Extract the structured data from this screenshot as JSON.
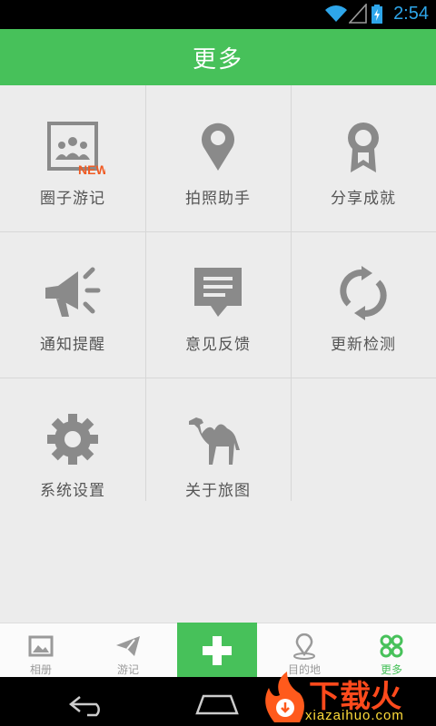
{
  "status_bar": {
    "time": "2:54"
  },
  "header": {
    "title": "更多"
  },
  "grid_items": [
    {
      "label": "圈子游记",
      "icon": "group-journal-icon",
      "badge": "NEW"
    },
    {
      "label": "拍照助手",
      "icon": "location-pin-icon"
    },
    {
      "label": "分享成就",
      "icon": "medal-icon"
    },
    {
      "label": "通知提醒",
      "icon": "megaphone-icon"
    },
    {
      "label": "意见反馈",
      "icon": "feedback-message-icon"
    },
    {
      "label": "更新检测",
      "icon": "refresh-icon"
    },
    {
      "label": "系统设置",
      "icon": "gear-icon"
    },
    {
      "label": "关于旅图",
      "icon": "camel-icon"
    }
  ],
  "tabs": [
    {
      "label": "相册",
      "icon": "photo-album-icon"
    },
    {
      "label": "游记",
      "icon": "paper-plane-icon"
    },
    {
      "label": "",
      "icon": "plus-icon"
    },
    {
      "label": "目的地",
      "icon": "destination-pin-icon"
    },
    {
      "label": "更多",
      "icon": "more-grid-icon"
    }
  ],
  "watermark": {
    "text": "下载火",
    "url": "xiazaihuo.com"
  },
  "colors": {
    "accent": "#47c15a",
    "icon_gray": "#8a8a8a",
    "badge": "#f05a22"
  }
}
